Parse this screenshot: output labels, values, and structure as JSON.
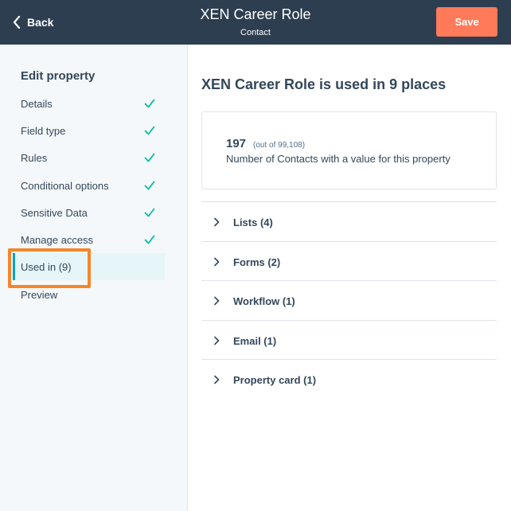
{
  "header": {
    "back_label": "Back",
    "title": "XEN Career Role",
    "subtitle": "Contact",
    "save_label": "Save"
  },
  "sidebar": {
    "heading": "Edit property",
    "items": [
      {
        "label": "Details",
        "complete": true
      },
      {
        "label": "Field type",
        "complete": true
      },
      {
        "label": "Rules",
        "complete": true
      },
      {
        "label": "Conditional options",
        "complete": true
      },
      {
        "label": "Sensitive Data",
        "complete": true
      },
      {
        "label": "Manage access",
        "complete": true
      },
      {
        "label": "Used in (9)",
        "active": true
      },
      {
        "label": "Preview"
      }
    ]
  },
  "main": {
    "heading": "XEN Career Role is used in 9 places",
    "stat": {
      "number": "197",
      "out_of": "(out of 99,108)",
      "description": "Number of Contacts with a value for this property"
    },
    "sections": [
      {
        "label": "Lists (4)"
      },
      {
        "label": "Forms (2)"
      },
      {
        "label": "Workflow (1)"
      },
      {
        "label": "Email (1)"
      },
      {
        "label": "Property card (1)"
      }
    ]
  },
  "colors": {
    "header_bg": "#2d3e50",
    "save_button": "#ff7a59",
    "check": "#00bda5",
    "active_bar": "#00a4bd",
    "highlight": "#f5862a"
  },
  "icons": {
    "back": "chevron-left-icon",
    "complete": "check-icon",
    "expand": "chevron-right-icon"
  }
}
